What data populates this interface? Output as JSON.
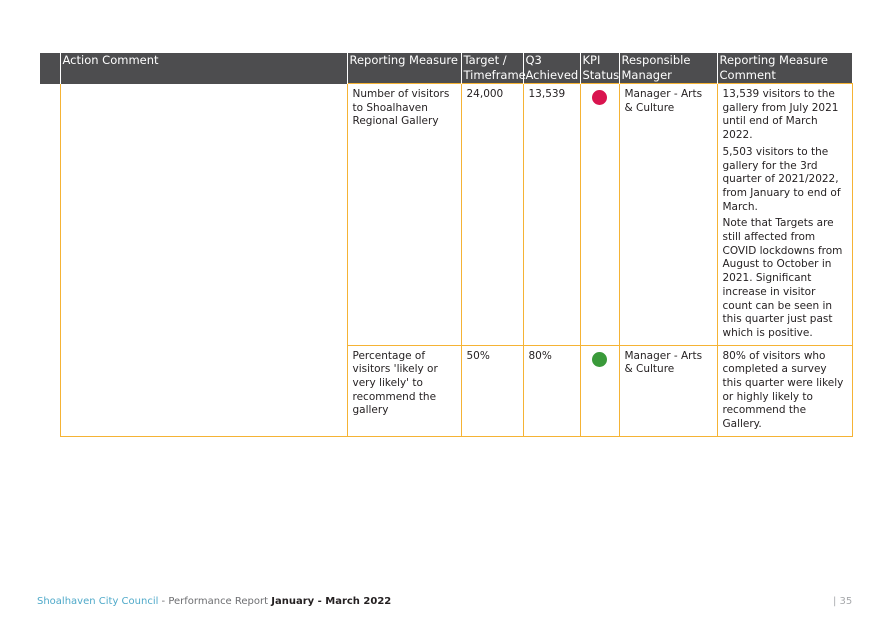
{
  "table": {
    "headers": {
      "action_comment": "Action Comment",
      "reporting_measure": "Reporting Measure",
      "target": "Target / Timeframe",
      "q3_achieved": "Q3 Achieved",
      "kpi_status": "KPI Status",
      "responsible_manager": "Responsible Manager",
      "reporting_measure_comment": "Reporting Measure Comment"
    },
    "action_comment": "",
    "rows": [
      {
        "reporting_measure": "Number of visitors to Shoalhaven Regional Gallery",
        "target": "24,000",
        "q3_achieved": "13,539",
        "kpi_status": "red",
        "kpi_color": "#d9144f",
        "responsible_manager": "Manager - Arts & Culture",
        "comment": [
          "13,539 visitors to the gallery from July 2021 until end of March 2022.",
          "5,503 visitors to the gallery for the 3rd quarter of 2021/2022, from January to end of March.",
          "Note that Targets are still affected from COVID lockdowns from August to October in 2021. Significant increase in visitor count can be seen in this quarter just past which is positive."
        ]
      },
      {
        "reporting_measure": "Percentage of visitors 'likely or very likely' to recommend the gallery",
        "target": "50%",
        "q3_achieved": "80%",
        "kpi_status": "green",
        "kpi_color": "#3a9a3a",
        "responsible_manager": "Manager - Arts & Culture",
        "comment": [
          "80% of visitors who completed a survey this quarter were likely or highly likely to recommend the Gallery."
        ]
      }
    ]
  },
  "footer": {
    "organisation": "Shoalhaven City Council",
    "separator": " - ",
    "report_label": "Performance Report ",
    "period": "January - March 2022",
    "page_number": "| 35"
  }
}
